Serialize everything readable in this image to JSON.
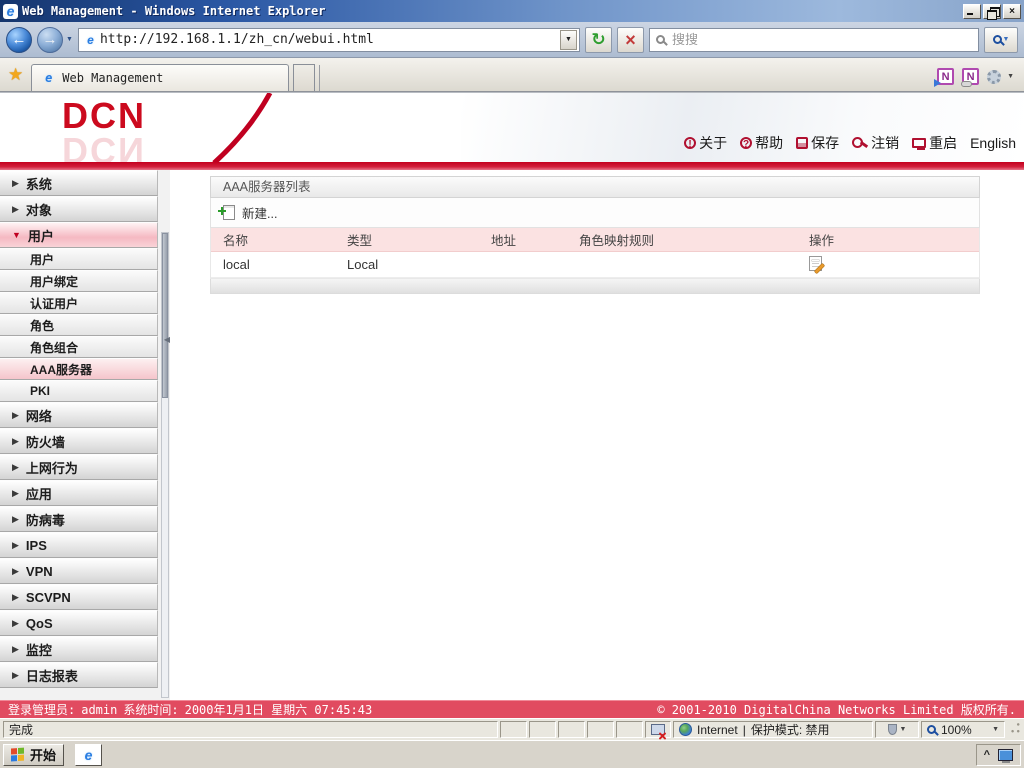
{
  "window": {
    "title": "Web Management - Windows Internet Explorer"
  },
  "browser": {
    "url": "http://192.168.1.1/zh_cn/webui.html",
    "search_placeholder": "搜搜",
    "tab_label": "Web Management"
  },
  "header": {
    "logo": "DCN",
    "links": [
      {
        "label": "关于"
      },
      {
        "label": "帮助"
      },
      {
        "label": "保存"
      },
      {
        "label": "注销"
      },
      {
        "label": "重启"
      },
      {
        "label": "English"
      }
    ]
  },
  "sidebar": {
    "items": [
      {
        "label": "系统",
        "type": "top"
      },
      {
        "label": "对象",
        "type": "top"
      },
      {
        "label": "用户",
        "type": "top",
        "state": "expanded"
      },
      {
        "label": "用户",
        "type": "sub"
      },
      {
        "label": "用户绑定",
        "type": "sub"
      },
      {
        "label": "认证用户",
        "type": "sub"
      },
      {
        "label": "角色",
        "type": "sub"
      },
      {
        "label": "角色组合",
        "type": "sub"
      },
      {
        "label": "AAA服务器",
        "type": "sub",
        "state": "selected"
      },
      {
        "label": "PKI",
        "type": "sub"
      },
      {
        "label": "网络",
        "type": "top"
      },
      {
        "label": "防火墙",
        "type": "top"
      },
      {
        "label": "上网行为",
        "type": "top"
      },
      {
        "label": "应用",
        "type": "top"
      },
      {
        "label": "防病毒",
        "type": "top"
      },
      {
        "label": "IPS",
        "type": "top"
      },
      {
        "label": "VPN",
        "type": "top"
      },
      {
        "label": "SCVPN",
        "type": "top"
      },
      {
        "label": "QoS",
        "type": "top"
      },
      {
        "label": "监控",
        "type": "top"
      },
      {
        "label": "日志报表",
        "type": "top"
      }
    ]
  },
  "panel": {
    "title": "AAA服务器列表",
    "new_button": "新建...",
    "table": {
      "headers": [
        "名称",
        "类型",
        "地址",
        "角色映射规则",
        "操作"
      ],
      "rows": [
        {
          "name": "local",
          "type": "Local",
          "address": "",
          "rules": ""
        }
      ]
    }
  },
  "site_footer": {
    "login_label": "登录管理员:",
    "admin": "admin",
    "time_label": "系统时间:",
    "time_value": "2000年1月1日 星期六 07:45:43",
    "copyright": "© 2001-2010 DigitalChina Networks Limited 版权所有."
  },
  "statusbar": {
    "done": "完成",
    "zone": "Internet",
    "separator": "|",
    "protected_mode": "保护模式: 禁用",
    "zoom": "100%"
  },
  "taskbar": {
    "start": "开始"
  },
  "icons": {
    "back": "←",
    "forward": "→",
    "dropdown": "▼",
    "refresh": "↻",
    "stop": "×",
    "star": "★",
    "close": "×",
    "note": "N",
    "arrow_right": "▶",
    "arrow_down": "▼",
    "collapse": "◀",
    "chevron": "^",
    "ie": "e",
    "about": "!",
    "help": "?"
  }
}
